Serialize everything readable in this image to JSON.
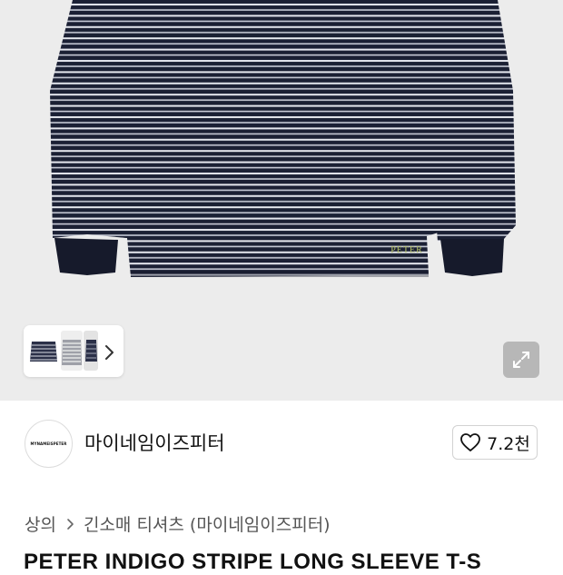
{
  "product": {
    "print_text": "PETER",
    "title": "PETER INDIGO STRIPE LONG SLEEVE T-S"
  },
  "gallery": {
    "thumbnail_count": 3,
    "thumb_next_icon": "chevron-right-icon",
    "expand_icon": "expand-icon"
  },
  "brand": {
    "logo_text": "MYNAMEISPETER",
    "name": "마이네임이즈피터"
  },
  "likes": {
    "icon": "heart-icon",
    "count": "7.2천"
  },
  "breadcrumb": {
    "items": [
      "상의",
      "긴소매 티셔츠 (마이네임이즈피터)"
    ],
    "separator_icon": "chevron-right-icon"
  },
  "colors": {
    "navy": "#1b2034",
    "stripe": "#e6e8ef",
    "hero_bg": "#ececec",
    "print": "#b9c56a"
  }
}
